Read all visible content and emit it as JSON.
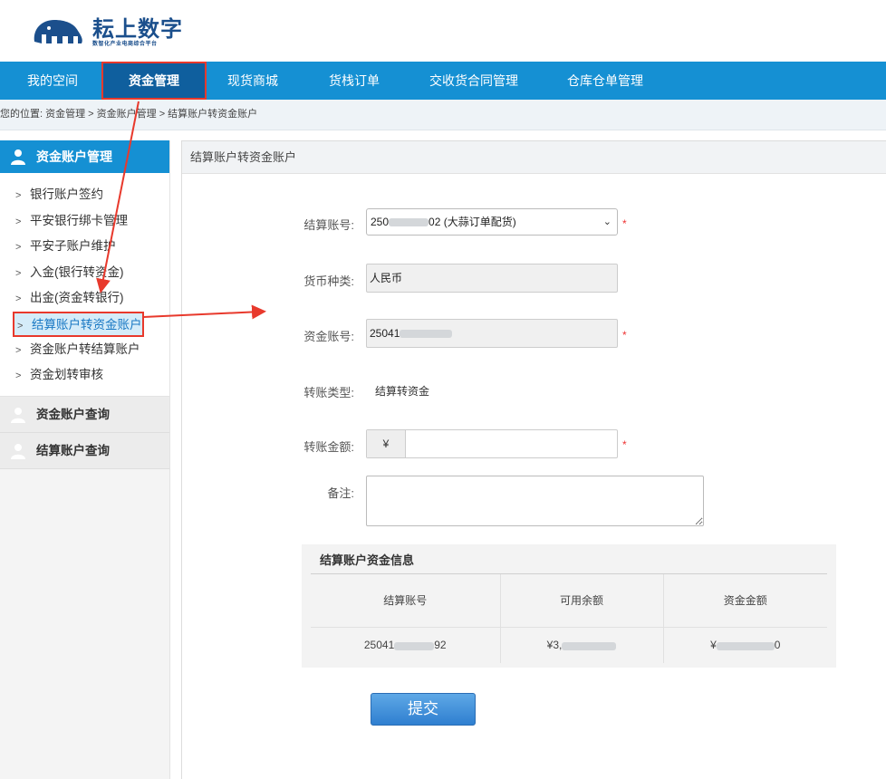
{
  "header": {
    "logo_title": "耘上数字",
    "logo_subtitle": "数智化产业电商综合平台"
  },
  "nav": {
    "items": [
      {
        "label": "我的空间"
      },
      {
        "label": "资金管理"
      },
      {
        "label": "现货商城"
      },
      {
        "label": "货栈订单"
      },
      {
        "label": "交收货合同管理"
      },
      {
        "label": "仓库仓单管理"
      }
    ],
    "active": "资金管理"
  },
  "breadcrumb": "您的位置:  资金管理 > 资金账户管理 > 结算账户转资金账户",
  "sidebar": {
    "section1_title": "资金账户管理",
    "items": [
      {
        "label": "银行账户签约"
      },
      {
        "label": "平安银行绑卡管理"
      },
      {
        "label": "平安子账户维护"
      },
      {
        "label": "入金(银行转资金)"
      },
      {
        "label": "出金(资金转银行)"
      },
      {
        "label": "结算账户转资金账户"
      },
      {
        "label": "资金账户转结算账户"
      },
      {
        "label": "资金划转审核"
      }
    ],
    "section2_title": "资金账户查询",
    "section3_title": "结算账户查询"
  },
  "panel": {
    "title": "结算账户转资金账户",
    "settlement_label": "结算账号:",
    "settlement_value_prefix": "250",
    "settlement_value_suffix": "02 (大蒜订单配货)",
    "currency_label": "货币种类:",
    "currency_value": "人民币",
    "fund_label": "资金账号:",
    "fund_value_prefix": "25041",
    "transfer_type_label": "转账类型:",
    "transfer_type_value": "结算转资金",
    "amount_label": "转账金额:",
    "amount_prefix": "¥",
    "amount_value": "",
    "remark_label": "备注:",
    "remark_value": "",
    "required_mark": "*"
  },
  "info": {
    "title": "结算账户资金信息",
    "columns": [
      "结算账号",
      "可用余额",
      "资金金额"
    ],
    "row": {
      "account_prefix": "25041",
      "account_suffix": "92",
      "available_prefix": "¥3,",
      "fund_prefix": "¥",
      "fund_suffix": "0"
    }
  },
  "submit_label": "提交",
  "colors": {
    "nav_bg": "#1590d3",
    "nav_active": "#0f5f9e",
    "annotation_red": "#e8392c",
    "required_red": "#e33333"
  }
}
